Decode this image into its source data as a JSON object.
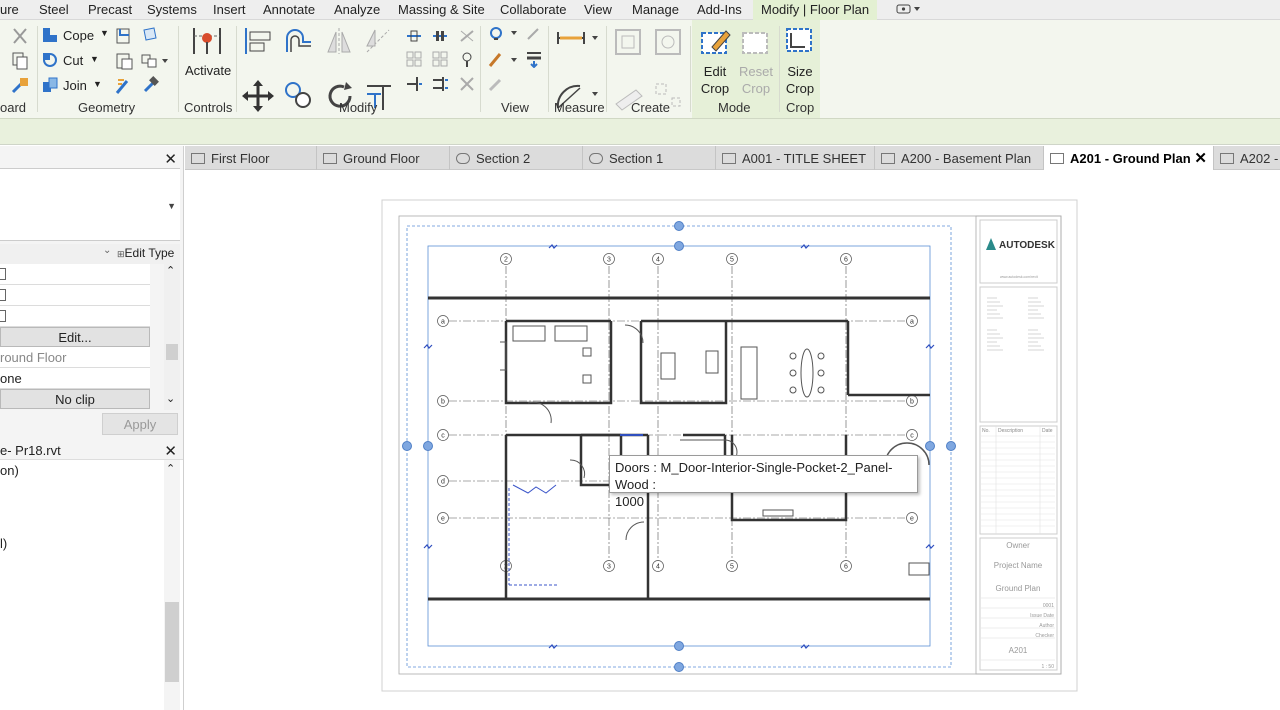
{
  "menubar": {
    "items": [
      "ure",
      "Steel",
      "Precast",
      "Systems",
      "Insert",
      "Annotate",
      "Analyze",
      "Massing & Site",
      "Collaborate",
      "View",
      "Manage",
      "Add-Ins",
      "Modify | Floor Plan"
    ],
    "active": "Modify | Floor Plan"
  },
  "ribbon": {
    "groups": {
      "clipboard": "oard",
      "geometry": "Geometry",
      "controls": "Controls",
      "modify": "Modify",
      "view": "View",
      "measure": "Measure",
      "create": "Create",
      "mode": "Mode",
      "crop": "Crop"
    },
    "tools": {
      "cope": "Cope",
      "cut": "Cut",
      "join": "Join",
      "activate": "Activate",
      "edit_crop": [
        "Edit",
        "Crop"
      ],
      "reset_crop": [
        "Reset",
        "Crop"
      ],
      "size_crop": [
        "Size",
        "Crop"
      ]
    },
    "colors": {
      "active_tab": "#e3f0d2",
      "mode_panel": "#e6f0d8",
      "accent_blue": "#2f73c9"
    }
  },
  "properties": {
    "edit_type": "Edit Type",
    "edit_btn": "Edit...",
    "view_name": "round Floor",
    "value_none": "one",
    "no_clip": "No clip",
    "apply": "Apply"
  },
  "browser": {
    "title": "e- Pr18.rvt",
    "items": [
      "on)",
      "l)"
    ]
  },
  "tabs": [
    {
      "label": "First Floor",
      "active": false
    },
    {
      "label": "Ground Floor",
      "active": false
    },
    {
      "label": "Section 2",
      "active": false
    },
    {
      "label": "Section 1",
      "active": false
    },
    {
      "label": "A001 - TITLE SHEET",
      "active": false
    },
    {
      "label": "A200 - Basement Plan",
      "active": false
    },
    {
      "label": "A201 - Ground Plan",
      "active": true
    },
    {
      "label": "A202 -",
      "active": false
    }
  ],
  "sheet": {
    "logo_text": "AUTODESK",
    "logo_url": "www.autodesk.com/revit",
    "owner": "Owner",
    "project_name": "Project Name",
    "sheet_title": "Ground Plan",
    "project_number": "0001",
    "issue_date": "Issue Date",
    "drawn_by": "Author",
    "checked_by": "Checker",
    "sheet_number": "A201",
    "scale": "1 : 50",
    "rev_headers": [
      "No.",
      "Description",
      "Date"
    ],
    "grid_labels_top": [
      "2",
      "3",
      "4",
      "5",
      "6"
    ],
    "grid_labels_side": [
      "a",
      "b",
      "c",
      "d",
      "e"
    ]
  },
  "tooltip": {
    "line1": "Doors : M_Door-Interior-Single-Pocket-2_Panel-Wood :",
    "line2": "1000"
  }
}
